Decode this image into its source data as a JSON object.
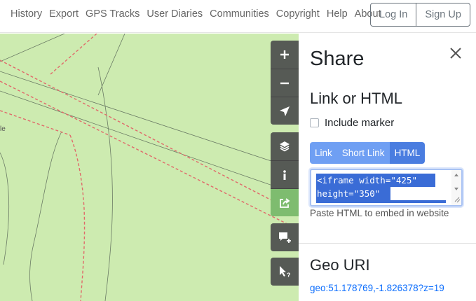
{
  "nav": {
    "links": [
      "History",
      "Export",
      "GPS Tracks",
      "User Diaries",
      "Communities",
      "Copyright",
      "Help",
      "About"
    ],
    "login": "Log In",
    "signup": "Sign Up"
  },
  "map": {
    "partial_label": "le",
    "controls": {
      "zoom_in": "zoom-in-icon",
      "zoom_out": "zoom-out-icon",
      "locate": "locate-arrow-icon",
      "layers": "layers-icon",
      "info": "info-icon",
      "share": "share-icon",
      "note": "add-note-icon",
      "query": "query-features-icon"
    },
    "colors": {
      "background": "#cdebb0",
      "control": "#565a55",
      "active_control": "#7ebc6f"
    }
  },
  "panel": {
    "title": "Share",
    "link_section": {
      "title": "Link or HTML",
      "include_marker": "Include marker",
      "tabs": [
        "Link",
        "Short Link",
        "HTML"
      ],
      "selected_tab": "HTML",
      "code_lines": [
        "<iframe width=\"425\"",
        "height=\"350\""
      ],
      "hint": "Paste HTML to embed in website"
    },
    "geo_section": {
      "title": "Geo URI",
      "uri": "geo:51.178769,-1.826378?z=19"
    }
  }
}
